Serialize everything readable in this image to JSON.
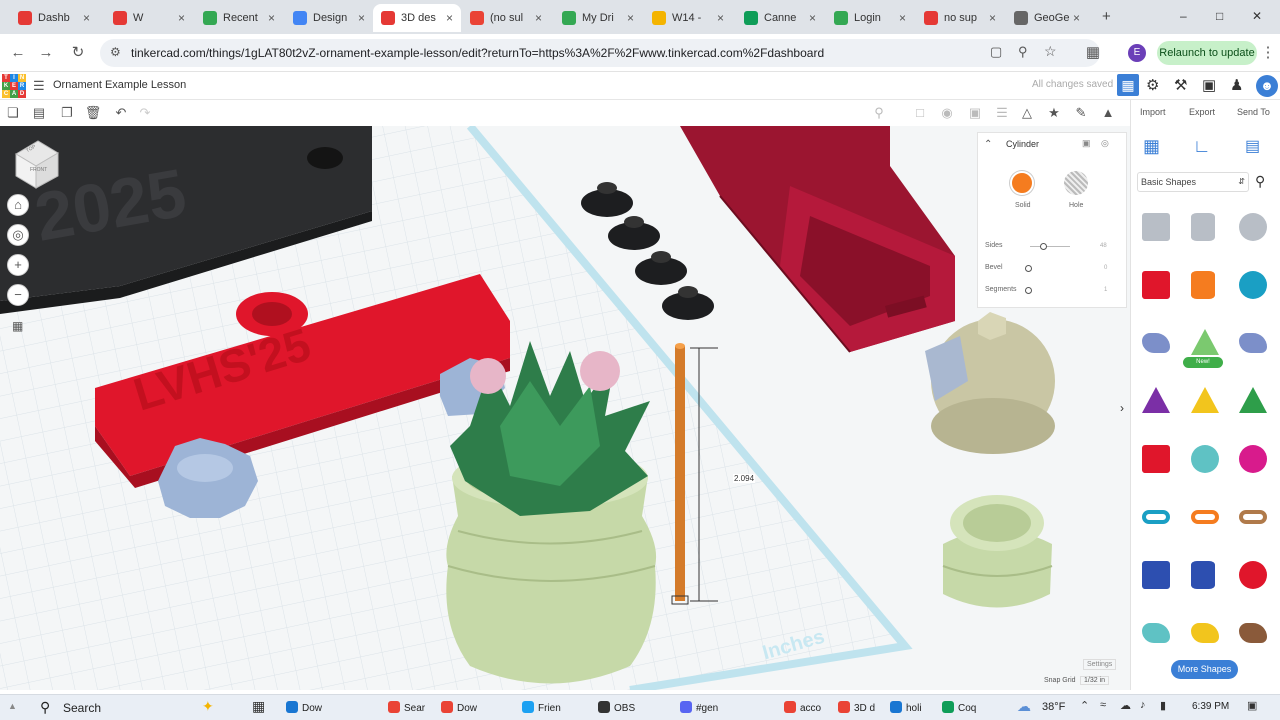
{
  "tabs": [
    {
      "label": "Dashb",
      "color": "#e53935"
    },
    {
      "label": "W",
      "color": "#e53935"
    },
    {
      "label": "Recent",
      "color": "#34a853"
    },
    {
      "label": "Design",
      "color": "#4285f4"
    },
    {
      "label": "3D des",
      "color": "#e53935",
      "active": true
    },
    {
      "label": "(no sul",
      "color": "#ea4335"
    },
    {
      "label": "My Dri",
      "color": "#34a853"
    },
    {
      "label": "W14 -",
      "color": "#f4b400"
    },
    {
      "label": "Canne",
      "color": "#0f9d58"
    },
    {
      "label": "Login",
      "color": "#34a853"
    },
    {
      "label": "no sup",
      "color": "#e53935"
    },
    {
      "label": "GeoGe",
      "color": "#666666"
    }
  ],
  "address": {
    "url": "tinkercad.com/things/1gLAT80t2vZ-ornament-example-lesson/edit?returnTo=https%3A%2F%2Fwww.tinkercad.com%2Fdashboard",
    "profile_letter": "E",
    "relaunch_label": "Relaunch to update"
  },
  "tinkercad": {
    "logo_letters": [
      "T",
      "I",
      "N",
      "K",
      "E",
      "R",
      "C",
      "A",
      "D"
    ],
    "doc_title": "Ornament Example Lesson",
    "save_status": "All changes saved"
  },
  "right_panel": {
    "import_label": "Import",
    "export_label": "Export",
    "sendto_label": "Send To",
    "library": "Basic Shapes",
    "new_badge": "New!",
    "more_shapes_label": "More Shapes"
  },
  "inspector": {
    "shape_name": "Cylinder",
    "solid_label": "Solid",
    "hole_label": "Hole",
    "props": [
      {
        "label": "Sides",
        "value": "48"
      },
      {
        "label": "Bevel",
        "value": "0"
      },
      {
        "label": "Segments",
        "value": "1"
      }
    ]
  },
  "workplane": {
    "dimension": "2.094",
    "units": "Inches",
    "settings_label": "Settings",
    "snap_label": "Snap Grid",
    "snap_value": "1/32 in",
    "viewcube_top": "TOP",
    "viewcube_front": "FRONT"
  },
  "taskbar": {
    "search_label": "Search",
    "weather": "38°F",
    "time": "6:39 PM",
    "apps": [
      {
        "label": "Dow",
        "color": "#1976d2"
      },
      {
        "label": "Sear",
        "color": "#ea4335"
      },
      {
        "label": "Dow",
        "color": "#ea4335"
      },
      {
        "label": "Frien",
        "color": "#1da1f2"
      },
      {
        "label": "OBS",
        "color": "#333333"
      },
      {
        "label": "#gen",
        "color": "#5865f2"
      },
      {
        "label": "acco",
        "color": "#ea4335"
      },
      {
        "label": "3D d",
        "color": "#ea4335"
      },
      {
        "label": "holi",
        "color": "#1976d2"
      },
      {
        "label": "Coq",
        "color": "#0f9d58"
      }
    ]
  },
  "colors": {
    "accent": "#3b7fd6",
    "solid": "#f57c1f",
    "red_model": "#e0162b",
    "dark_red_model": "#9b1530",
    "pot_green": "#c6d9a8",
    "plant_green": "#2e7d4a",
    "gear_blue": "#9db4d6"
  }
}
